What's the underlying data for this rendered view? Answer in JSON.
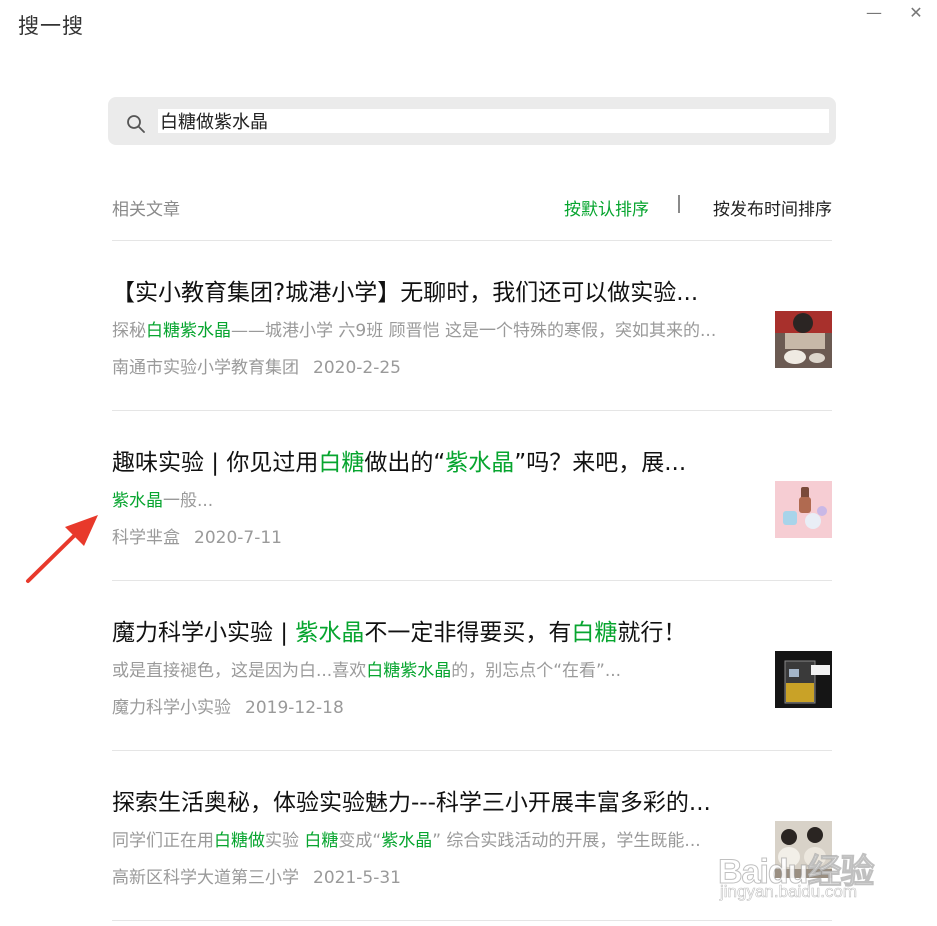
{
  "window": {
    "title": "搜一搜",
    "minimize_glyph": "—",
    "close_glyph": "✕"
  },
  "search": {
    "query": "白糖做紫水晶",
    "icon": "search-icon"
  },
  "section": {
    "label": "相关文章",
    "sort_default": "按默认排序",
    "sort_time": "按发布时间排序"
  },
  "accent_color": "#07a52f",
  "results": [
    {
      "title": [
        {
          "t": "【实小教育集团?城港小学】无聊时，我们还可以做实验..."
        }
      ],
      "snippet": [
        {
          "t": "探秘"
        },
        {
          "t": "白糖紫水晶",
          "hl": true
        },
        {
          "t": "——城港小学 六9班 顾晋恺 这是一个特殊的寒假，突如其来的..."
        }
      ],
      "source": "南通市实验小学教育集团",
      "date": "2020-2-25",
      "thumb": "photo-child-experiment"
    },
    {
      "title": [
        {
          "t": "趣味实验 | 你见过用"
        },
        {
          "t": "白糖",
          "hl": true
        },
        {
          "t": "做出的“"
        },
        {
          "t": "紫水晶",
          "hl": true
        },
        {
          "t": "”吗？来吧，展..."
        }
      ],
      "snippet": [
        {
          "t": "紫水晶",
          "hl": true
        },
        {
          "t": "一般..."
        }
      ],
      "source": "科学芈盒",
      "date": "2020-7-11",
      "thumb": "photo-pink-bottles"
    },
    {
      "title": [
        {
          "t": "魔力科学小实验 | "
        },
        {
          "t": "紫水晶",
          "hl": true
        },
        {
          "t": "不一定非得要买，有"
        },
        {
          "t": "白糖",
          "hl": true
        },
        {
          "t": "就行！"
        }
      ],
      "snippet": [
        {
          "t": "或是直接褪色，这是因为白...喜欢"
        },
        {
          "t": "白糖紫水晶",
          "hl": true
        },
        {
          "t": "的，别忘点个“在看”..."
        }
      ],
      "source": "魔力科学小实验",
      "date": "2019-12-18",
      "thumb": "photo-beaker"
    },
    {
      "title": [
        {
          "t": "探索生活奥秘，体验实验魅力---科学三小开展丰富多彩的..."
        }
      ],
      "snippet": [
        {
          "t": "同学们正在用"
        },
        {
          "t": "白糖做",
          "hl": true
        },
        {
          "t": "实验 "
        },
        {
          "t": "白糖",
          "hl": true
        },
        {
          "t": "变成“"
        },
        {
          "t": "紫水晶",
          "hl": true
        },
        {
          "t": "” 综合实践活动的开展，学生既能..."
        }
      ],
      "source": "高新区科学大道第三小学",
      "date": "2021-5-31",
      "thumb": "photo-classroom"
    }
  ],
  "watermark": {
    "main": "Baidu经验",
    "sub": "jingyan.baidu.com"
  }
}
